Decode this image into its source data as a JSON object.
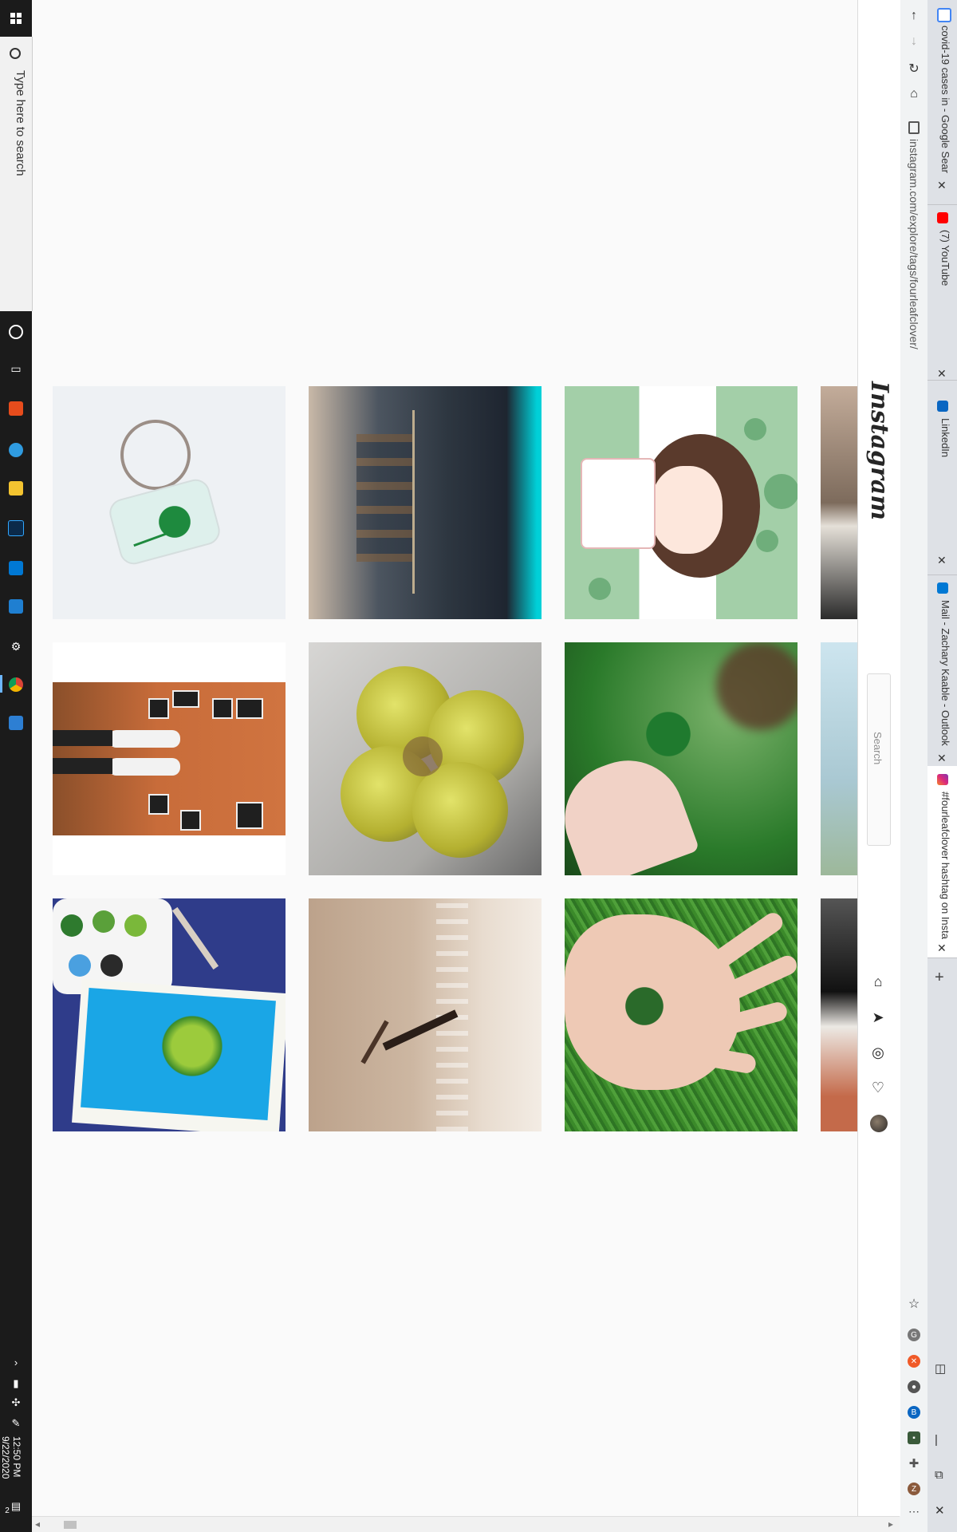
{
  "taskbar": {
    "search_placeholder": "Type here to search",
    "clock_time": "12:50 PM",
    "clock_date": "9/22/2020",
    "notification_count": "2"
  },
  "browser": {
    "tabs": [
      {
        "title": "covid-19 cases in - Google Sear",
        "icon": "google-icon",
        "color": "#4285f4"
      },
      {
        "title": "(7) YouTube",
        "icon": "youtube-icon",
        "color": "#ff0000"
      },
      {
        "title": "LinkedIn",
        "icon": "linkedin-icon",
        "color": "#0a66c2"
      },
      {
        "title": "Mail - Zachary Kaable - Outlook",
        "icon": "outlook-icon",
        "color": "#0078d4"
      },
      {
        "title": "#fourleafclover hashtag on Insta",
        "icon": "instagram-icon",
        "color": "#e1306c"
      }
    ],
    "new_tab_label": "+",
    "address": "instagram.com/explore/tags/fourleafclover/"
  },
  "instagram": {
    "logo_text": "Instagram",
    "search_placeholder": "Search"
  },
  "grid": {
    "rows": [
      [
        "keychain-clover",
        "fourleaf-clover-store",
        "anime-girl-clovers",
        "partial-book"
      ],
      [
        "couple-photo-wall",
        "dried-yellow-clover",
        "hand-holding-clover",
        "partial-sky"
      ],
      [
        "clover-painting",
        "beach-yoga",
        "palm-with-clover",
        "partial-dog"
      ]
    ]
  }
}
